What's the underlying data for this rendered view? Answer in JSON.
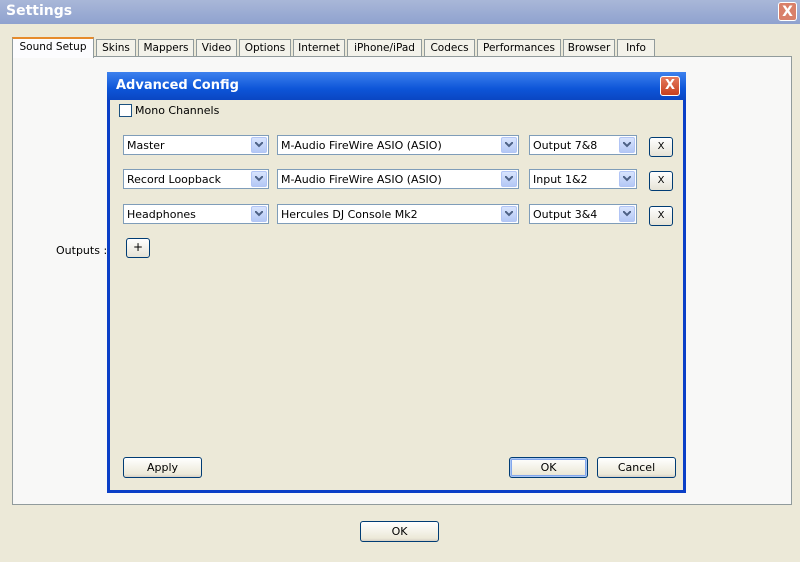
{
  "window": {
    "title": "Settings",
    "close_label": "X"
  },
  "tabs": [
    "Sound Setup",
    "Skins",
    "Mappers",
    "Video",
    "Options",
    "Internet",
    "iPhone/iPad",
    "Codecs",
    "Performances",
    "Browser",
    "Info"
  ],
  "panel": {
    "outputs_label": "Outputs :"
  },
  "dialog": {
    "title": "Advanced Config",
    "close_label": "X",
    "mono_channels_label": "Mono Channels",
    "rows": [
      {
        "output": "Master",
        "device": "M-Audio FireWire ASIO (ASIO)",
        "channel": "Output 7&8",
        "remove_label": "X"
      },
      {
        "output": "Record Loopback",
        "device": "M-Audio FireWire ASIO (ASIO)",
        "channel": "Input 1&2",
        "remove_label": "X"
      },
      {
        "output": "Headphones",
        "device": "Hercules DJ Console Mk2",
        "channel": "Output 3&4",
        "remove_label": "X"
      }
    ],
    "add_label": "+",
    "apply_label": "Apply",
    "ok_label": "OK",
    "cancel_label": "Cancel"
  },
  "footer": {
    "ok_label": "OK"
  },
  "colors": {
    "dialog_title": "#0d55d8",
    "tab_highlight": "#e68b2c",
    "surface": "#ece9d8"
  }
}
